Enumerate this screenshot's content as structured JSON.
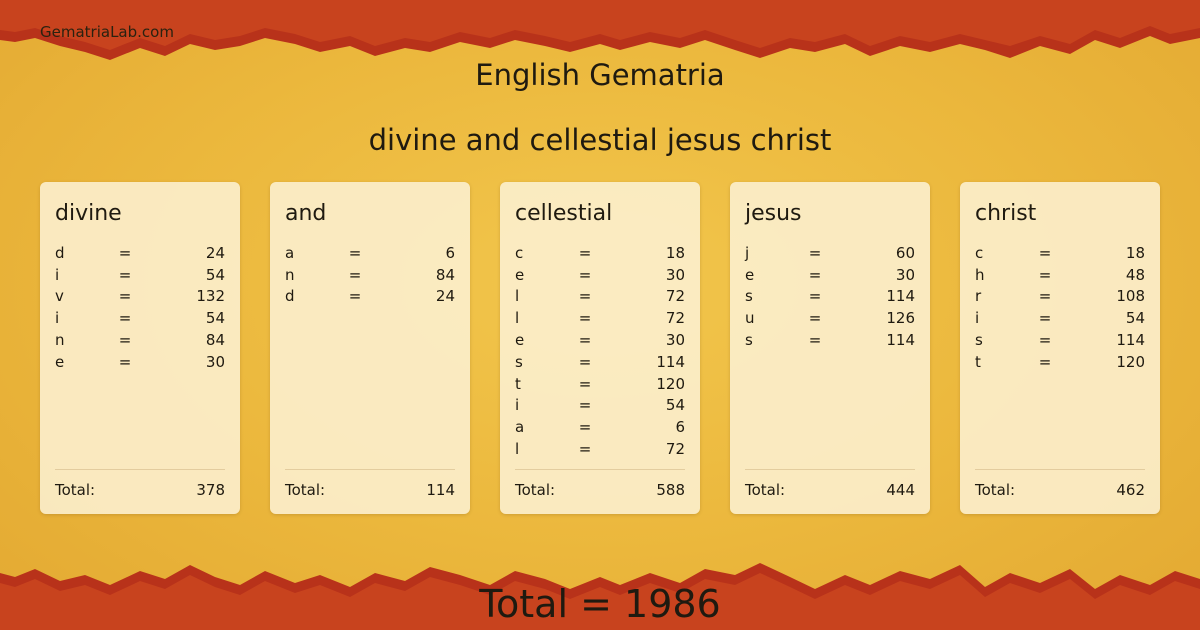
{
  "site": "GematriaLab.com",
  "title": "English Gematria",
  "phrase": "divine and cellestial jesus christ",
  "words": [
    {
      "word": "divine",
      "rows": [
        [
          "d",
          "24"
        ],
        [
          "i",
          "54"
        ],
        [
          "v",
          "132"
        ],
        [
          "i",
          "54"
        ],
        [
          "n",
          "84"
        ],
        [
          "e",
          "30"
        ]
      ],
      "total_label": "Total:",
      "total": "378"
    },
    {
      "word": "and",
      "rows": [
        [
          "a",
          "6"
        ],
        [
          "n",
          "84"
        ],
        [
          "d",
          "24"
        ]
      ],
      "total_label": "Total:",
      "total": "114"
    },
    {
      "word": "cellestial",
      "rows": [
        [
          "c",
          "18"
        ],
        [
          "e",
          "30"
        ],
        [
          "l",
          "72"
        ],
        [
          "l",
          "72"
        ],
        [
          "e",
          "30"
        ],
        [
          "s",
          "114"
        ],
        [
          "t",
          "120"
        ],
        [
          "i",
          "54"
        ],
        [
          "a",
          "6"
        ],
        [
          "l",
          "72"
        ]
      ],
      "total_label": "Total:",
      "total": "588"
    },
    {
      "word": "jesus",
      "rows": [
        [
          "j",
          "60"
        ],
        [
          "e",
          "30"
        ],
        [
          "s",
          "114"
        ],
        [
          "u",
          "126"
        ],
        [
          "s",
          "114"
        ]
      ],
      "total_label": "Total:",
      "total": "444"
    },
    {
      "word": "christ",
      "rows": [
        [
          "c",
          "18"
        ],
        [
          "h",
          "48"
        ],
        [
          "r",
          "108"
        ],
        [
          "i",
          "54"
        ],
        [
          "s",
          "114"
        ],
        [
          "t",
          "120"
        ]
      ],
      "total_label": "Total:",
      "total": "462"
    }
  ],
  "equals": "=",
  "grand_total": "Total = 1986",
  "colors": {
    "accent_red": "#c0391b",
    "paper": "#eab63a"
  }
}
